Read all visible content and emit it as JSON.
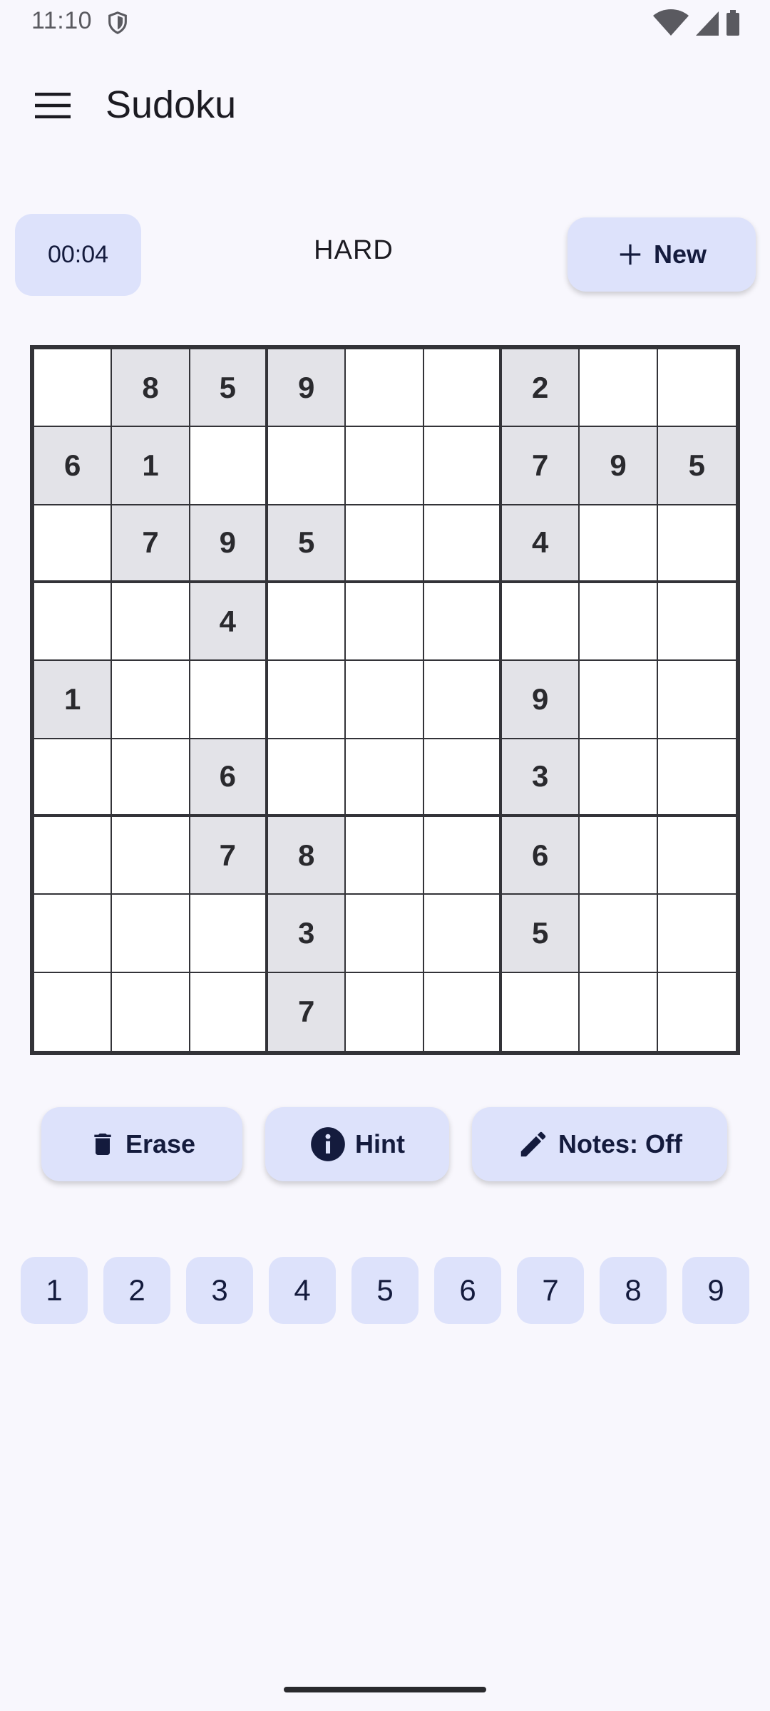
{
  "status_bar": {
    "time": "11:10",
    "icons": [
      "shield-icon",
      "wifi-icon",
      "signal-icon",
      "battery-icon"
    ]
  },
  "app_bar": {
    "title": "Sudoku",
    "menu_icon": "menu-icon"
  },
  "game": {
    "timer": "00:04",
    "difficulty": "HARD",
    "new_label": "New"
  },
  "board": {
    "rows": [
      [
        "",
        "8",
        "5",
        "9",
        "",
        "",
        "2",
        "",
        ""
      ],
      [
        "6",
        "1",
        "",
        "",
        "",
        "",
        "7",
        "9",
        "5"
      ],
      [
        "",
        "7",
        "9",
        "5",
        "",
        "",
        "4",
        "",
        ""
      ],
      [
        "",
        "",
        "4",
        "",
        "",
        "",
        "",
        "",
        ""
      ],
      [
        "1",
        "",
        "",
        "",
        "",
        "",
        "9",
        "",
        ""
      ],
      [
        "",
        "",
        "6",
        "",
        "",
        "",
        "3",
        "",
        ""
      ],
      [
        "",
        "",
        "7",
        "8",
        "",
        "",
        "6",
        "",
        ""
      ],
      [
        "",
        "",
        "",
        "3",
        "",
        "",
        "5",
        "",
        ""
      ],
      [
        "",
        "",
        "",
        "7",
        "",
        "",
        "",
        "",
        ""
      ]
    ]
  },
  "actions": {
    "erase_label": "Erase",
    "hint_label": "Hint",
    "notes_label": "Notes: Off"
  },
  "number_pad": [
    "1",
    "2",
    "3",
    "4",
    "5",
    "6",
    "7",
    "8",
    "9"
  ],
  "colors": {
    "background": "#f8f7fd",
    "tonal_button": "#dde2fb",
    "on_tonal": "#141b3d",
    "given_cell": "#e3e3e8",
    "grid_line": "#333338"
  }
}
